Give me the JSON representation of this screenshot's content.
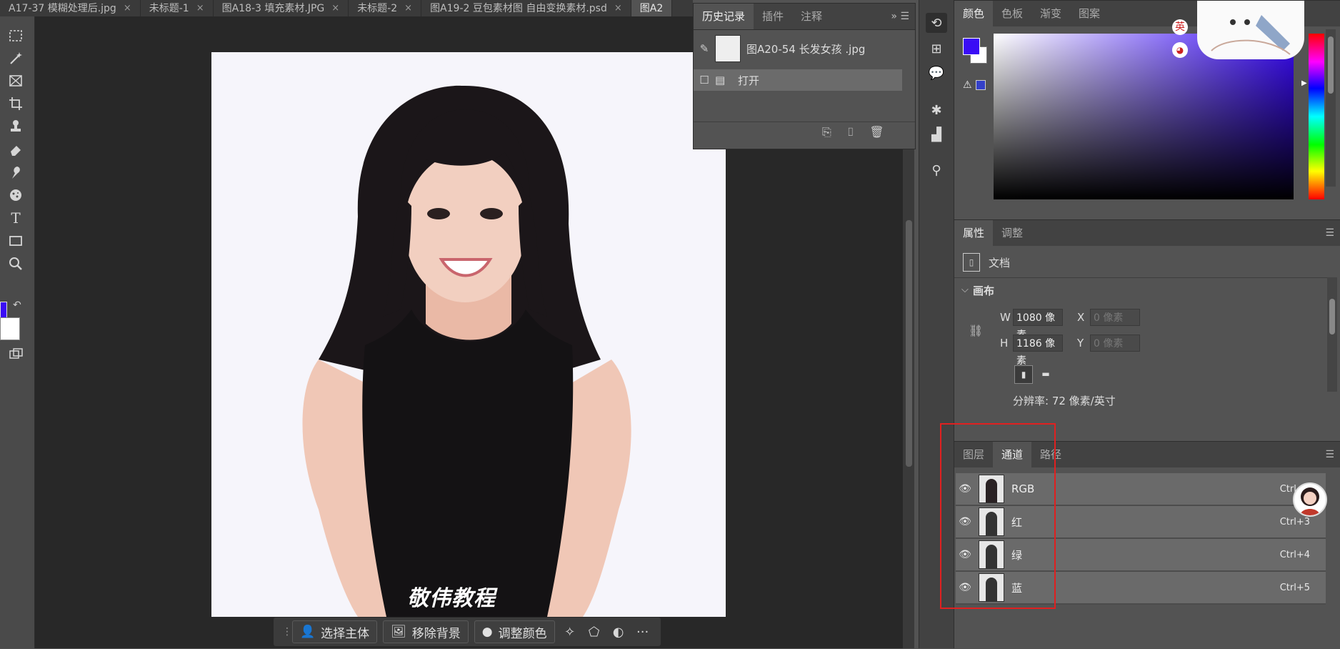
{
  "document_tabs": [
    {
      "label": "A17-37 模糊处理后.jpg",
      "active": false
    },
    {
      "label": "未标题-1",
      "active": false
    },
    {
      "label": "图A18-3 填充素材.JPG",
      "active": false
    },
    {
      "label": "未标题-2",
      "active": false
    },
    {
      "label": "图A19-2 豆包素材图 自由变换素材.psd",
      "active": false
    },
    {
      "label": "图A2",
      "active": true
    }
  ],
  "close_glyph": "×",
  "colors": {
    "foreground": "#3a0cf5",
    "background": "#ffffff",
    "highlight_box": "#e02020"
  },
  "canvas": {
    "watermark": "敬伟教程"
  },
  "taskbar": {
    "select_subject": "选择主体",
    "remove_background": "移除背景",
    "adjust_color": "调整颜色",
    "more": "···"
  },
  "history_panel": {
    "tabs": [
      "历史记录",
      "插件",
      "注释"
    ],
    "snapshot_name": "图A20-54 长发女孩 .jpg",
    "steps": [
      {
        "label": "打开"
      }
    ]
  },
  "color_panel": {
    "tabs": [
      "颜色",
      "色板",
      "渐变",
      "图案"
    ],
    "ime_badge": "英"
  },
  "properties_panel": {
    "tabs": [
      "属性",
      "调整"
    ],
    "section": "文档",
    "canvas_heading": "画布",
    "w_label": "W",
    "w_value": "1080 像素",
    "h_label": "H",
    "h_value": "1186 像素",
    "x_label": "X",
    "x_placeholder": "0 像素",
    "y_label": "Y",
    "y_placeholder": "0 像素",
    "resolution": "分辨率: 72 像素/英寸"
  },
  "layers_panel": {
    "tabs": [
      "图层",
      "通道",
      "路径"
    ],
    "active_tab": "通道",
    "channels": [
      {
        "name": "RGB",
        "shortcut": "Ctrl+2"
      },
      {
        "name": "红",
        "shortcut": "Ctrl+3"
      },
      {
        "name": "绿",
        "shortcut": "Ctrl+4"
      },
      {
        "name": "蓝",
        "shortcut": "Ctrl+5"
      }
    ]
  }
}
